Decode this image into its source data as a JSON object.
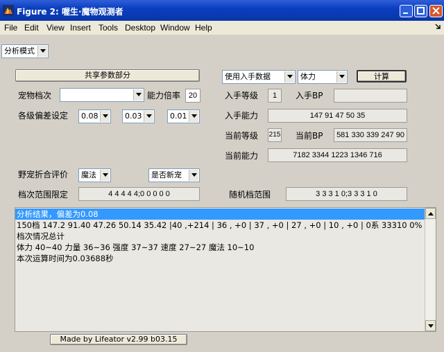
{
  "window": {
    "title": "Figure 2: 喔生·魔物观测者",
    "icons": [
      "matlab-icon",
      "minimize-icon",
      "maximize-icon",
      "close-icon"
    ]
  },
  "menu": [
    "File",
    "Edit",
    "View",
    "Insert",
    "Tools",
    "Desktop",
    "Window",
    "Help"
  ],
  "mode_select": "分析模式",
  "shared_button": "共享参数部分",
  "input_source_select": "使用入手数据",
  "attr_select": "体力",
  "calc_button": "计算",
  "pet_grade": {
    "label": "宠物档次",
    "value": ""
  },
  "ability_multiplier": {
    "label": "能力倍率",
    "value": "20"
  },
  "deviation": {
    "label": "各级偏差设定",
    "values": [
      "0.08",
      "0.03",
      "0.01"
    ]
  },
  "entry_level": {
    "label": "入手等级",
    "value": "1"
  },
  "entry_bp": {
    "label": "入手BP",
    "value": ""
  },
  "entry_ability": {
    "label": "入手能力",
    "value": "147 91 47 50 35"
  },
  "current_level": {
    "label": "当前等级",
    "value": "215"
  },
  "current_bp": {
    "label": "当前BP",
    "value": "581 330 339 247 90"
  },
  "current_ability": {
    "label": "当前能力",
    "value": "7182 3344 1223 1346 716"
  },
  "wild_eval": {
    "label": "野宠折合评价",
    "value": "魔法"
  },
  "newborn_select": "是否新宠",
  "grade_range": {
    "label": "档次范围限定",
    "value": "4 4 4 4 4;0 0 0 0 0"
  },
  "random_range": {
    "label": "随机档范围",
    "value": "3 3 3 1 0;3 3 3 1 0"
  },
  "results": [
    "分析结果，偏差为0.08",
    "150档 147.2 91.40 47.26 50.14 35.42 |40 ,+214 | 36 , +0 | 37 , +0 | 27 , +0 | 10 , +0 | 0系 33310   0% *",
    "档次情况总计",
    "体力 40~40 力量 36~36 强度 37~37 速度 27~27 魔法 10~10",
    "本次运算时间为0.03688秒"
  ],
  "footer_button": "Made by Lifeator   v2.99 b03.15"
}
